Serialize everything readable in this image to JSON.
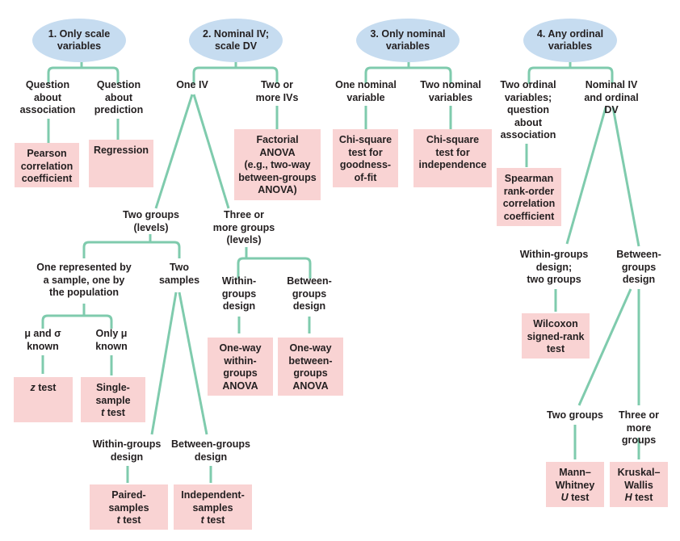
{
  "diagram": {
    "type": "decision-tree",
    "colors": {
      "start_node": "#c6dcf0",
      "test_box": "#f9d3d3",
      "connector": "#7fcbad",
      "text": "#231f20"
    },
    "roots": [
      {
        "id": "r1",
        "label": "1. Only scale\nvariables"
      },
      {
        "id": "r2",
        "label": "2. Nominal IV;\nscale DV"
      },
      {
        "id": "r3",
        "label": "3. Only nominal\nvariables"
      },
      {
        "id": "r4",
        "label": "4. Any ordinal\nvariables"
      }
    ],
    "conditions": {
      "q_assoc": "Question\nabout\nassociation",
      "q_pred": "Question\nabout\nprediction",
      "one_iv": "One IV",
      "two_ivs": "Two or\nmore IVs",
      "one_nom": "One nominal\nvariable",
      "two_nom": "Two nominal\nvariables",
      "two_ord": "Two ordinal\nvariables;\nquestion\nabout\nassociation",
      "nom_ord": "Nominal IV\nand ordinal DV",
      "two_groups": "Two groups\n(levels)",
      "three_groups": "Three or\nmore groups\n(levels)",
      "one_sample": "One represented by\na sample, one by\nthe population",
      "two_samples": "Two\nsamples",
      "within_anova": "Within-\ngroups\ndesign",
      "between_anova": "Between-\ngroups\ndesign",
      "mu_sigma": "μ and σ\nknown",
      "only_mu": "Only μ\nknown",
      "within_t": "Within-groups\ndesign",
      "between_t": "Between-groups\ndesign",
      "within_ord": "Within-groups\ndesign;\ntwo groups",
      "between_ord": "Between-\ngroups\ndesign",
      "two_groups_ord": "Two groups",
      "three_groups_ord": "Three or\nmore groups"
    },
    "tests": {
      "pearson": "Pearson\ncorrelation\ncoefficient",
      "regression": "Regression",
      "factorial": "Factorial\nANOVA\n(e.g., two-way\nbetween-groups\nANOVA)",
      "chi_gof": "Chi-square\ntest for\ngoodness-\nof-fit",
      "chi_ind": "Chi-square\ntest for\nindependence",
      "spearman": "Spearman\nrank-order\ncorrelation\ncoefficient",
      "anova_within": "One-way\nwithin-\ngroups\nANOVA",
      "anova_between": "One-way\nbetween-\ngroups\nANOVA",
      "z_test": {
        "italic": "z",
        "rest": " test"
      },
      "single_t": {
        "pre": "Single-\nsample\n",
        "italic": "t",
        "rest": " test"
      },
      "paired_t": {
        "pre": "Paired-\nsamples\n",
        "italic": "t",
        "rest": " test"
      },
      "indep_t": {
        "pre": "Independent-\nsamples\n",
        "italic": "t",
        "rest": " test"
      },
      "wilcoxon": "Wilcoxon\nsigned-rank\ntest",
      "mann_whitney": {
        "pre": "Mann–\nWhitney\n",
        "italic": "U",
        "rest": " test"
      },
      "kruskal": {
        "pre": "Kruskal–\nWallis\n",
        "italic": "H",
        "rest": " test"
      }
    }
  }
}
